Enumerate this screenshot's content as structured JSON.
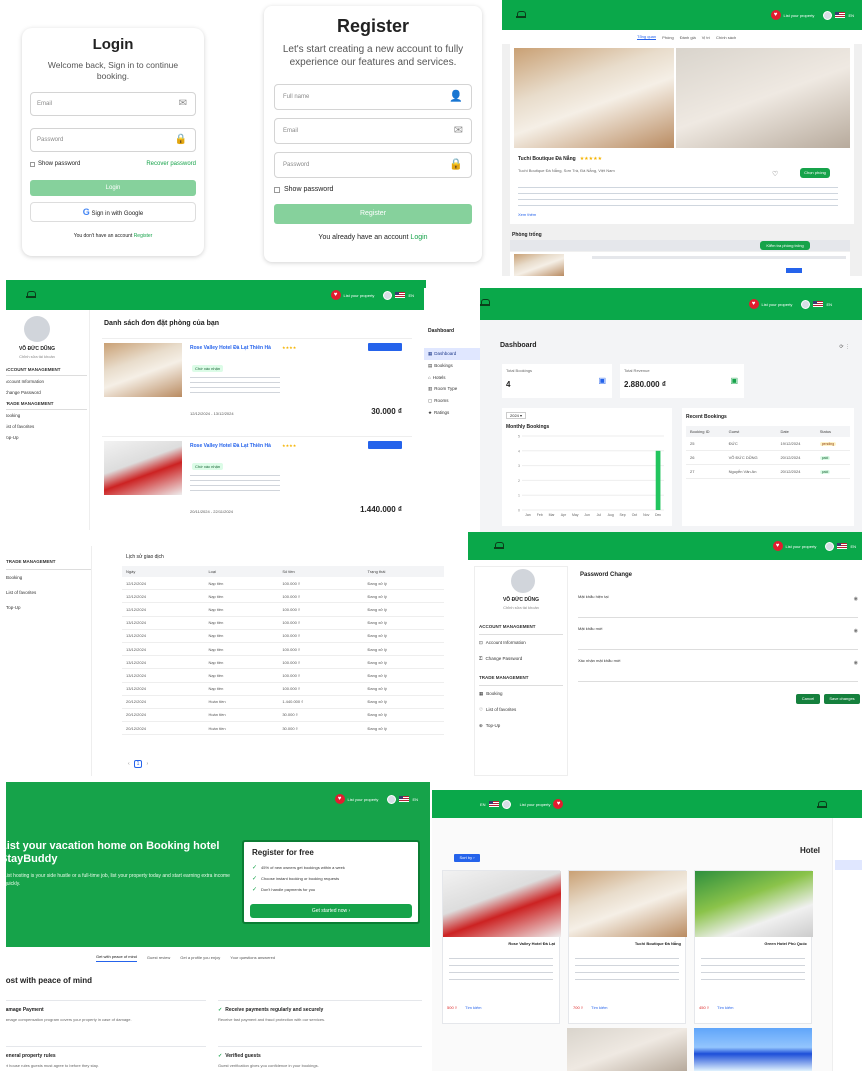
{
  "login": {
    "title": "Login",
    "subtitle": "Welcome back, Sign in to continue booking.",
    "email_placeholder": "Email",
    "password_placeholder": "Password",
    "show_password": "Show password",
    "recover": "Recover password",
    "login_btn": "Login",
    "google_btn": "Sign in with Google",
    "no_account": "You don't have an account",
    "register_link": "Register"
  },
  "register": {
    "title": "Register",
    "subtitle": "Let's start creating a new account to fully experience our features and services.",
    "fullname_placeholder": "Full name",
    "email_placeholder": "Email",
    "password_placeholder": "Password",
    "show_password": "Show password",
    "register_btn": "Register",
    "have_account": "You already have an account",
    "login_link": "Login"
  },
  "header": {
    "list_property": "List your property",
    "lang": "EN"
  },
  "hotel_detail": {
    "tabs": [
      "Tổng quan",
      "Phòng",
      "Đánh giá",
      "Vị trí",
      "Chính sách"
    ],
    "name": "Tuchi Boutique Đà Nẵng",
    "address": "Tuchi Boutique Đà Nẵng, Sơn Trà, Đà Nẵng, Việt Nam",
    "select_btn": "Chọn phòng",
    "rooms_heading": "Phòng trống",
    "check_btn": "Kiểm tra phòng trống",
    "view_more": "Xem thêm"
  },
  "favorites": {
    "heading": "Danh sách đơn đặt phòng của bạn",
    "profile_name": "VÕ ĐỨC DŨNG",
    "profile_sub": "Chỉnh sửa tài khoản",
    "sidebar": [
      "ACCOUNT MANAGEMENT",
      "Account Information",
      "Change Password",
      "TRADE MANAGEMENT",
      "Booking",
      "List of favorites",
      "Top-Up"
    ],
    "items": [
      {
        "name": "Rose Valley Hotel Đà Lạt Thiên Hà",
        "badge": "Chờ xác nhận",
        "price": "30.000 ₫",
        "dates": "12/12/2024 - 13/12/2024"
      },
      {
        "name": "Rose Valley Hotel Đà Lạt Thiên Hà",
        "badge": "Chờ xác nhận",
        "price": "1.440.000 ₫",
        "dates": "20/11/2024 - 22/11/2024"
      }
    ]
  },
  "dashboard": {
    "title": "Dashboard",
    "brand": "Dashboard",
    "nav": [
      "Dashboard",
      "Bookings",
      "Hotels",
      "Room Type",
      "Rooms",
      "Ratings"
    ],
    "total_bookings_label": "Total Bookings",
    "total_bookings": "4",
    "total_revenue_label": "Total Revenue",
    "total_revenue": "2.880.000 ₫",
    "year": "2024",
    "chart_title": "Monthly Bookings",
    "recent_title": "Recent Bookings",
    "recent_headers": [
      "Booking ID",
      "Guest",
      "Date",
      "Status"
    ],
    "recent_rows": [
      [
        "25",
        "ĐỨC",
        "19/12/2024",
        "pending"
      ],
      [
        "26",
        "VÕ ĐỨC DŨNG",
        "20/12/2024",
        "paid"
      ],
      [
        "27",
        "Nguyễn Văn An",
        "20/12/2024",
        "paid"
      ]
    ]
  },
  "chart_data": {
    "type": "bar",
    "categories": [
      "Jan",
      "Feb",
      "Mar",
      "Apr",
      "May",
      "Jun",
      "Jul",
      "Aug",
      "Sep",
      "Oct",
      "Nov",
      "Dec"
    ],
    "series": [
      {
        "values": [
          0,
          0,
          0,
          0,
          0,
          0,
          0,
          0,
          0,
          0,
          0,
          4
        ]
      }
    ],
    "ylim": [
      0,
      5
    ],
    "title": "Monthly Bookings"
  },
  "transactions": {
    "heading": "Lịch sử giao dịch",
    "headers": [
      "Ngày",
      "Loại",
      "Số tiền",
      "Trạng thái"
    ],
    "sidebar": [
      "TRADE MANAGEMENT",
      "Booking",
      "List of favorites",
      "Top-Up"
    ],
    "rows": [
      [
        "12/12/2024",
        "Nạp tiền",
        "100.000 ₫",
        "Đang xử lý"
      ],
      [
        "12/12/2024",
        "Nạp tiền",
        "100.000 ₫",
        "Đang xử lý"
      ],
      [
        "12/12/2024",
        "Nạp tiền",
        "100.000 ₫",
        "Đang xử lý"
      ],
      [
        "13/12/2024",
        "Nạp tiền",
        "100.000 ₫",
        "Đang xử lý"
      ],
      [
        "13/12/2024",
        "Nạp tiền",
        "100.000 ₫",
        "Đang xử lý"
      ],
      [
        "13/12/2024",
        "Nạp tiền",
        "100.000 ₫",
        "Đang xử lý"
      ],
      [
        "13/12/2024",
        "Nạp tiền",
        "100.000 ₫",
        "Đang xử lý"
      ],
      [
        "13/12/2024",
        "Nạp tiền",
        "100.000 ₫",
        "Đang xử lý"
      ],
      [
        "13/12/2024",
        "Nạp tiền",
        "100.000 ₫",
        "Đang xử lý"
      ],
      [
        "20/12/2024",
        "Hoàn tiền",
        "1.440.000 ₫",
        "Đang xử lý"
      ],
      [
        "20/12/2024",
        "Hoàn tiền",
        "30.000 ₫",
        "Đang xử lý"
      ],
      [
        "20/12/2024",
        "Hoàn tiền",
        "30.000 ₫",
        "Đang xử lý"
      ]
    ],
    "page": "1"
  },
  "password_change": {
    "title": "Password Change",
    "profile_name": "VÕ ĐỨC DŨNG",
    "profile_sub": "Chỉnh sửa tài khoản",
    "sidebar": [
      "ACCOUNT MANAGEMENT",
      "Account Information",
      "Change Password",
      "TRADE MANAGEMENT",
      "Booking",
      "List of favorites",
      "Top-Up"
    ],
    "fields": [
      "Mật khẩu hiện tại",
      "Mật khẩu mới",
      "Xác nhận mật khẩu mới"
    ],
    "cancel": "Cancel",
    "save": "Save changes"
  },
  "list_property": {
    "hero_title": "List your vacation home on Booking hotel StayBuddy",
    "hero_text": "List hosting is your side hustle or a full-time job, list your property today and start earning extra income quickly.",
    "register_title": "Register for free",
    "checks": [
      "45% of new owners get bookings within a week",
      "Choose instant booking or booking requests",
      "Don't handle payments for you"
    ],
    "get_started": "Get started now",
    "tabs": [
      "Get with peace of mind",
      "Guest review",
      "Get a profile you enjoy",
      "Your questions answered"
    ],
    "section_title": "Host with peace of mind",
    "features": [
      {
        "title": "Damage Payment",
        "text": "Damage compensation program covers your property in case of damage."
      },
      {
        "title": "Receive payments regularly and securely",
        "text": "Receive fast payment and fraud protection with our services."
      },
      {
        "title": "General property rules",
        "text": "Set house rules guests must agree to before they stay."
      },
      {
        "title": "Verified guests",
        "text": "Guest verification gives you confidence in your bookings."
      }
    ]
  },
  "hotel_list": {
    "title": "Hotel",
    "filter": "Sort by",
    "search_btn": "Tìm kiếm",
    "cards": [
      {
        "name": "Rose Valley Hotel Đà Lạt",
        "price": "500 ₫"
      },
      {
        "name": "Tuchi Boutique Đà Nẵng",
        "price": "700 ₫"
      },
      {
        "name": "Green Hotel Phú Quốc",
        "price": "450 ₫"
      }
    ]
  }
}
